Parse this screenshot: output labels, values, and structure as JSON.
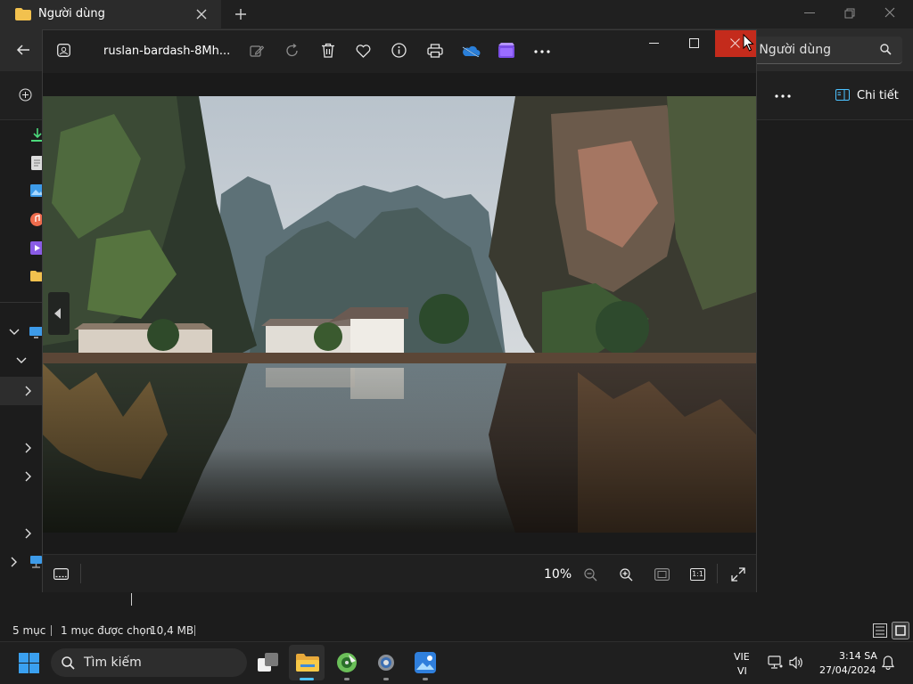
{
  "explorer": {
    "tab_title": "Người dùng",
    "search_placeholder": "g Người dùng",
    "details_label": "Chi tiết",
    "status": {
      "item_count": "5 mục",
      "selected": "1 mục được chọn",
      "size": "10,4 MB"
    }
  },
  "photos": {
    "filename": "ruslan-bardash-8Mh...",
    "zoom": "10%",
    "actual_size_label": "1:1"
  },
  "taskbar": {
    "search_placeholder": "Tìm kiếm",
    "lang_top": "VIE",
    "lang_bottom": "VI",
    "time": "3:14 SA",
    "date": "27/04/2024"
  },
  "colors": {
    "close_red": "#c42b1c",
    "accent_blue": "#0a84ff",
    "folder_yellow": "#f2c14e"
  }
}
